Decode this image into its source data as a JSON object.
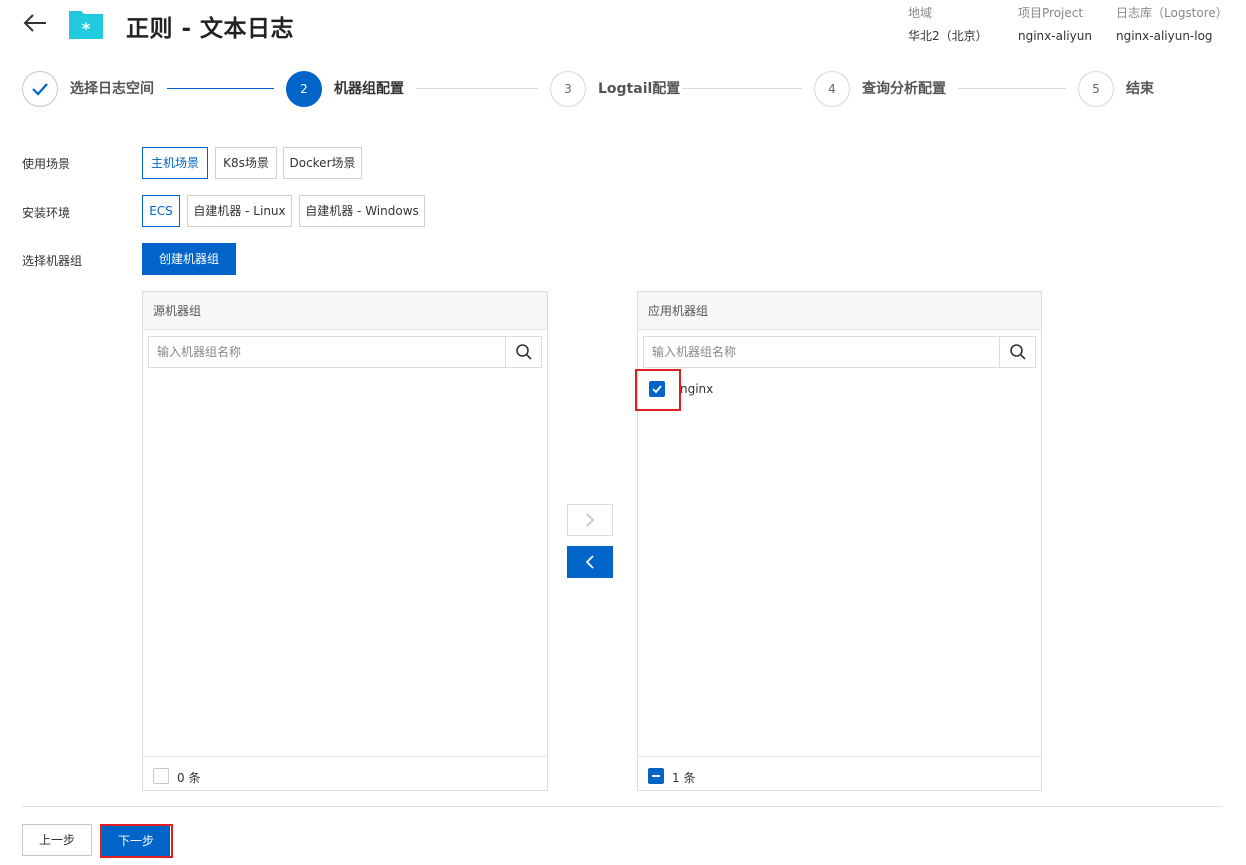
{
  "header": {
    "title": "正则 - 文本日志",
    "meta": [
      {
        "key": "地域",
        "value": "华北2（北京）"
      },
      {
        "key": "项目Project",
        "value": "nginx-aliyun"
      },
      {
        "key": "日志库（Logstore）",
        "value": "nginx-aliyun-log"
      }
    ]
  },
  "steps": [
    {
      "num": "",
      "label": "选择日志空间",
      "state": "done"
    },
    {
      "num": "2",
      "label": "机器组配置",
      "state": "active"
    },
    {
      "num": "3",
      "label": "Logtail配置",
      "state": "pending"
    },
    {
      "num": "4",
      "label": "查询分析配置",
      "state": "pending"
    },
    {
      "num": "5",
      "label": "结束",
      "state": "pending"
    }
  ],
  "form": {
    "scene_label": "使用场景",
    "scene_options": [
      "主机场景",
      "K8s场景",
      "Docker场景"
    ],
    "scene_selected": "主机场景",
    "env_label": "安装环境",
    "env_options": [
      "ECS",
      "自建机器 - Linux",
      "自建机器 - Windows"
    ],
    "env_selected": "ECS",
    "group_label": "选择机器组",
    "create_group_button": "创建机器组"
  },
  "transfer": {
    "source": {
      "title": "源机器组",
      "search_placeholder": "输入机器组名称",
      "items": [],
      "footer_count": "0 条"
    },
    "target": {
      "title": "应用机器组",
      "search_placeholder": "输入机器组名称",
      "items": [
        {
          "label": "nginx",
          "checked": true
        }
      ],
      "footer_count": "1 条"
    }
  },
  "footer": {
    "prev_button": "上一步",
    "next_button": "下一步"
  },
  "colors": {
    "accent": "#0064c8",
    "highlight": "#e02020"
  }
}
